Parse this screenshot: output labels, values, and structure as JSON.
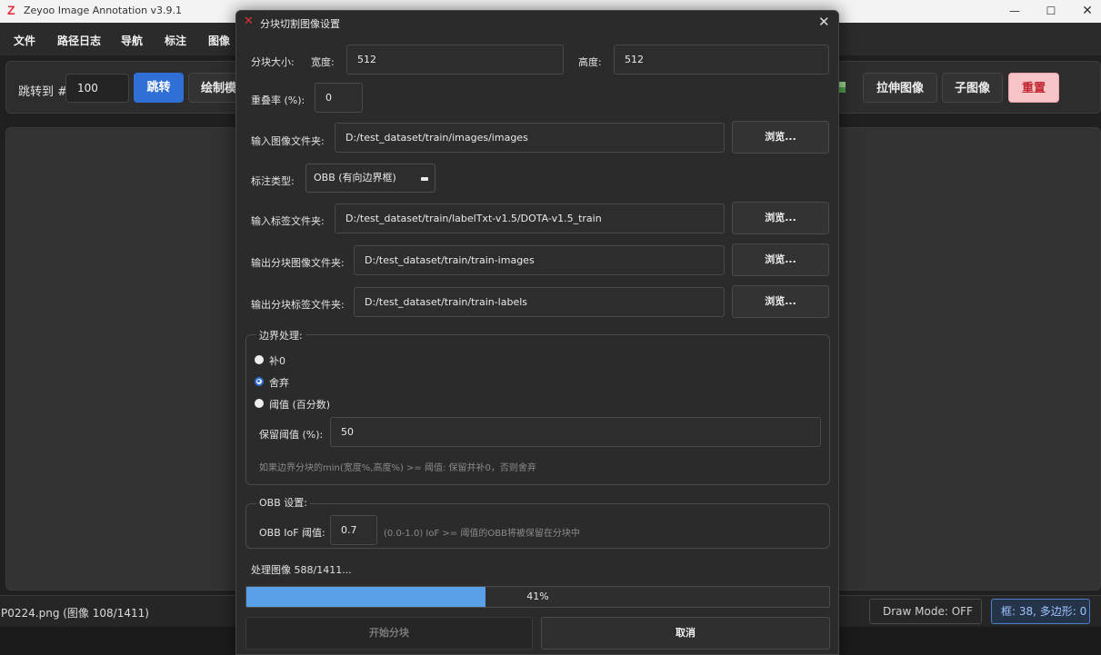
{
  "app": {
    "logo": "Z",
    "title": "Zeyoo Image Annotation v3.9.1",
    "window_controls": {
      "minimize": "—",
      "maximize": "☐",
      "close": "✕"
    }
  },
  "menu": [
    "文件",
    "路径日志",
    "导航",
    "标注",
    "图像"
  ],
  "toolbar": {
    "jump_label": "跳转到 #",
    "jump_value": "100",
    "jump_button": "跳转",
    "draw_button": "绘制模",
    "stretch_button": "拉伸图像",
    "sub_image_button": "子图像",
    "reset_button": "重置"
  },
  "status": {
    "file": "P0224.png (图像 108/1411)",
    "draw_mode": "Draw Mode: OFF",
    "counts": "框: 38, 多边形: 0"
  },
  "dialog": {
    "title": "分块切割图像设置",
    "close": "✕",
    "tile_size_label": "分块大小:",
    "width_label": "宽度:",
    "width_value": "512",
    "height_label": "高度:",
    "height_value": "512",
    "overlap_label": "重叠率 (%):",
    "overlap_value": "0",
    "input_images_label": "输入图像文件夹:",
    "input_images_value": "D:/test_dataset/train/images/images",
    "annotation_type_label": "标注类型:",
    "annotation_type_value": "OBB (有向边界框)",
    "input_labels_label": "输入标签文件夹:",
    "input_labels_value": "D:/test_dataset/train/labelTxt-v1.5/DOTA-v1.5_train",
    "output_images_label": "输出分块图像文件夹:",
    "output_images_value": "D:/test_dataset/train/train-images",
    "output_labels_label": "输出分块标签文件夹:",
    "output_labels_value": "D:/test_dataset/train/train-labels",
    "browse_label": "浏览...",
    "border": {
      "title": "边界处理:",
      "options": [
        "补0",
        "舍弃",
        "阈值 (百分数)"
      ],
      "selected": "舍弃",
      "keep_threshold_label": "保留阈值 (%):",
      "keep_threshold_value": "50",
      "hint": "如果边界分块的min(宽度%,高度%) >= 阈值: 保留并补0，否则舍弃"
    },
    "obb": {
      "title": "OBB 设置:",
      "iof_label": "OBB IoF 阈值:",
      "iof_value": "0.7",
      "hint": "(0.0-1.0) IoF >= 阈值的OBB将被保留在分块中"
    },
    "progress": {
      "status_text": "处理图像 588/1411...",
      "fraction": 0.41,
      "percent_text": "41%",
      "color": "#5aa0e8"
    },
    "start_button": "开始分块",
    "cancel_button": "取消"
  },
  "colors": {
    "accent": "#2f6fd6",
    "reset_bg": "#f7c5c8",
    "reset_text": "#c0262d",
    "dialog_bg": "#2b2b2b"
  }
}
